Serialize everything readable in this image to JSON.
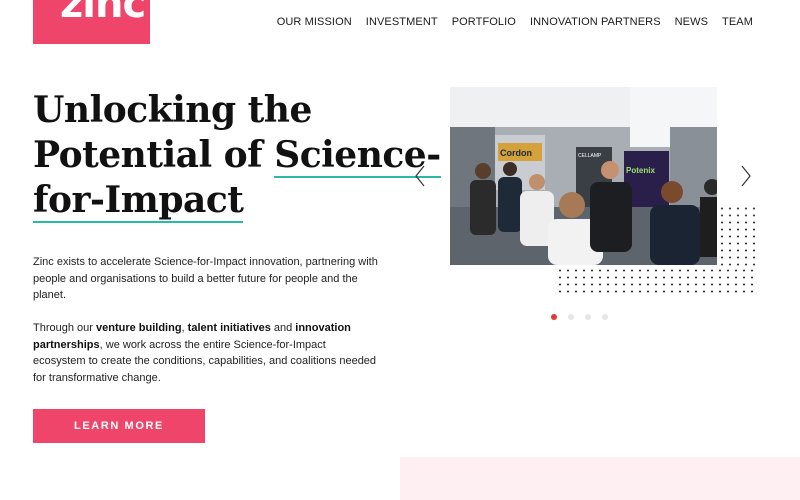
{
  "brand": {
    "logo_text": "zinc",
    "accent_color": "#f0456a",
    "underline_color": "#2bb8a5"
  },
  "nav": {
    "items": [
      {
        "label": "OUR MISSION"
      },
      {
        "label": "INVESTMENT"
      },
      {
        "label": "PORTFOLIO"
      },
      {
        "label": "INNOVATION PARTNERS"
      },
      {
        "label": "NEWS"
      },
      {
        "label": "TEAM"
      }
    ]
  },
  "hero": {
    "title_line1": "Unlocking the",
    "title_line2a": "Potential of ",
    "title_line2b": "Science-",
    "title_line3": "for-Impact",
    "para1": "Zinc exists to accelerate Science-for-Impact innovation, partnering with people and organisations to build a better future for people and the planet.",
    "para2_prefix": "Through our ",
    "para2_bold1": "venture building",
    "para2_sep1": ", ",
    "para2_bold2": "talent initiatives",
    "para2_sep2": " and ",
    "para2_bold3": "innovation partnerships",
    "para2_suffix": ", we work across the entire Science-for-Impact ecosystem to create the conditions, capabilities, and coalitions needed for transformative change.",
    "cta_label": "LEARN MORE"
  },
  "carousel": {
    "active_index": 0,
    "slide_count": 4,
    "banner_labels": [
      "Cordon",
      "CELLAMP",
      "Potenix"
    ],
    "prev_icon": "chevron-left-icon",
    "next_icon": "chevron-right-icon"
  }
}
